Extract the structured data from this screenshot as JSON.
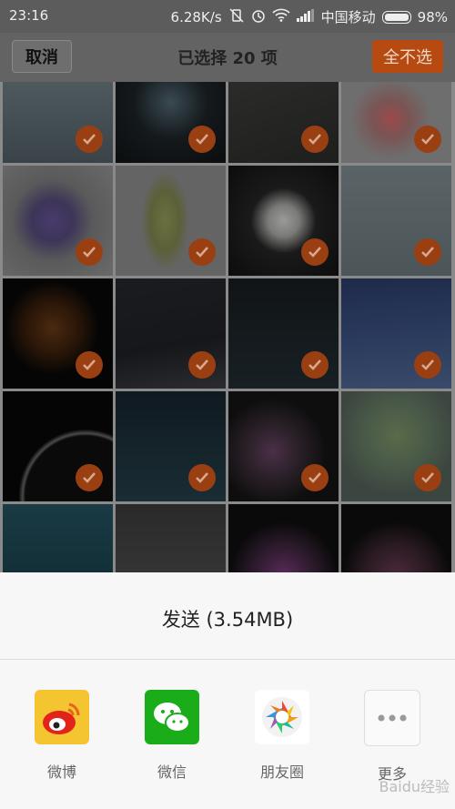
{
  "status_bar": {
    "time": "23:16",
    "speed": "6.28K/s",
    "carrier": "中国移动",
    "battery": "98%"
  },
  "top_bar": {
    "cancel_label": "取消",
    "title": "已选择 20 项",
    "deselect_all_label": "全不选"
  },
  "grid": {
    "selected_count": 20,
    "accent": "#b64a10"
  },
  "share_sheet": {
    "send_label": "发送 (3.54MB)",
    "targets": [
      {
        "label": "微博",
        "icon": "weibo-icon"
      },
      {
        "label": "微信",
        "icon": "wechat-icon"
      },
      {
        "label": "朋友圈",
        "icon": "moments-icon"
      },
      {
        "label": "更多",
        "icon": "more-icon"
      }
    ],
    "watermark": "Baidu经验"
  }
}
